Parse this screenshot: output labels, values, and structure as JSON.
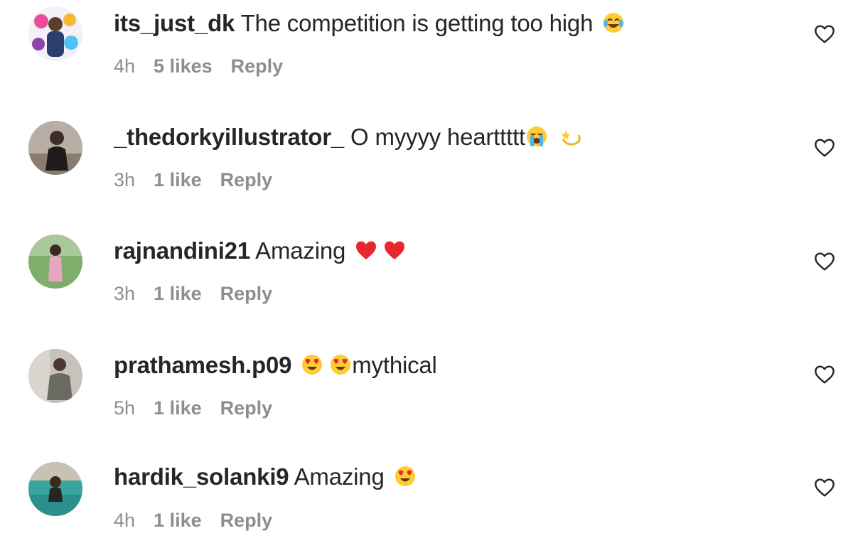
{
  "comments": [
    {
      "username": "its_just_dk",
      "text": "The competition is getting too high",
      "emojis_after": [
        "tears-of-joy"
      ],
      "time": "4h",
      "likes": "5 likes",
      "reply": "Reply"
    },
    {
      "username": "_thedorkyillustrator_",
      "text": "O myyyy hearttttt",
      "emojis_after": [
        "loudly-crying",
        "dizzy"
      ],
      "time": "3h",
      "likes": "1 like",
      "reply": "Reply"
    },
    {
      "username": "rajnandini21",
      "text": "Amazing",
      "emojis_after": [
        "red-heart",
        "red-heart"
      ],
      "time": "3h",
      "likes": "1 like",
      "reply": "Reply"
    },
    {
      "username": "prathamesh.p09",
      "text": "mythical",
      "emojis_before": [
        "heart-eyes",
        "heart-eyes"
      ],
      "time": "5h",
      "likes": "1 like",
      "reply": "Reply"
    },
    {
      "username": "hardik_solanki9",
      "text": "Amazing",
      "emojis_after": [
        "heart-eyes"
      ],
      "time": "4h",
      "likes": "1 like",
      "reply": "Reply"
    }
  ],
  "icons": {
    "like": "heart-outline-icon"
  },
  "colors": {
    "text": "#262626",
    "secondary": "#8e8e8e",
    "background": "#ffffff"
  }
}
